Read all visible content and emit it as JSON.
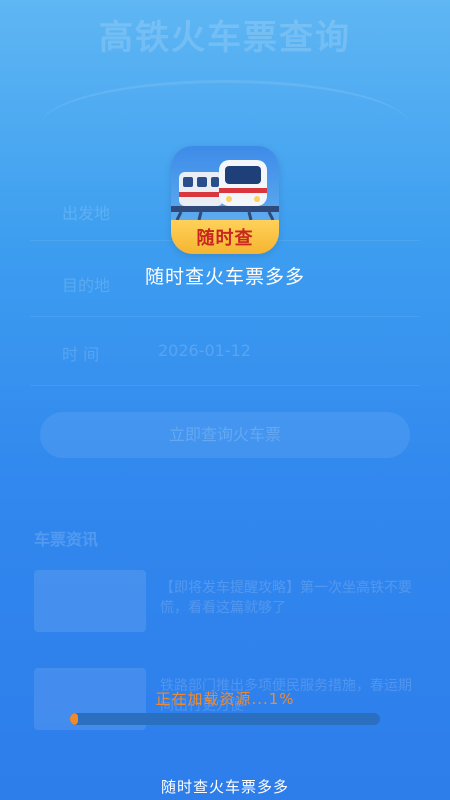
{
  "background": {
    "title": "高铁火车票查询",
    "from_label": "出发地",
    "to_label": "目的地",
    "date_label": "时 间",
    "date_value": "2026-01-12",
    "search_button": "立即查询火车票",
    "news_header": "车票资讯",
    "news_items": [
      "【即将发车提醒攻略】第一次坐高铁不要慌，看看这篇就够了",
      "铁路部门推出多项便民服务措施，春运期间出行更方便"
    ]
  },
  "splash": {
    "logo_text": "随时查",
    "app_name": "随时查火车票多多",
    "logo_icon": "train-icon"
  },
  "loading": {
    "text": "正在加载资源...1%",
    "progress": 0.01,
    "color": "#f28a2b"
  },
  "footer": {
    "text": "随时查火车票多多"
  },
  "colors": {
    "background_top": "#5fb6f3",
    "background_bottom": "#2d7deb",
    "accent_orange": "#f28a2b",
    "logo_band": "#ffd15a",
    "logo_text": "#c8261f"
  }
}
